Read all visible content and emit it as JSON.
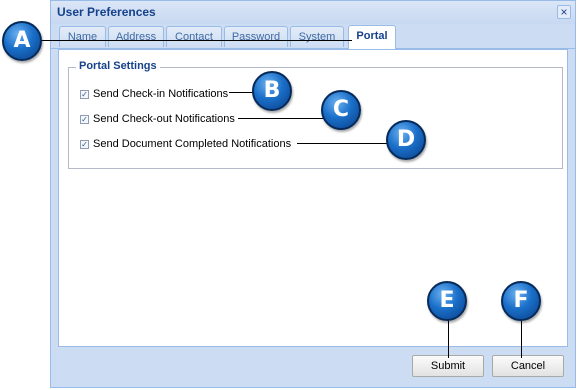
{
  "dialog": {
    "title": "User Preferences",
    "close_glyph": "×"
  },
  "tabs": [
    {
      "label": "Name",
      "active": false
    },
    {
      "label": "Address",
      "active": false
    },
    {
      "label": "Contact",
      "active": false
    },
    {
      "label": "Password",
      "active": false
    },
    {
      "label": "System",
      "active": false
    },
    {
      "label": "Portal",
      "active": true
    }
  ],
  "portal_settings": {
    "legend": "Portal Settings",
    "checkboxes": [
      {
        "label": "Send Check-in Notifications",
        "checked": true
      },
      {
        "label": "Send Check-out Notifications",
        "checked": true
      },
      {
        "label": "Send Document Completed Notifications",
        "checked": true
      }
    ]
  },
  "buttons": {
    "submit": "Submit",
    "cancel": "Cancel"
  },
  "callouts": [
    "A",
    "B",
    "C",
    "D",
    "E",
    "F"
  ],
  "colors": {
    "accent": "#15428b",
    "callout": "#1a6fc9"
  }
}
